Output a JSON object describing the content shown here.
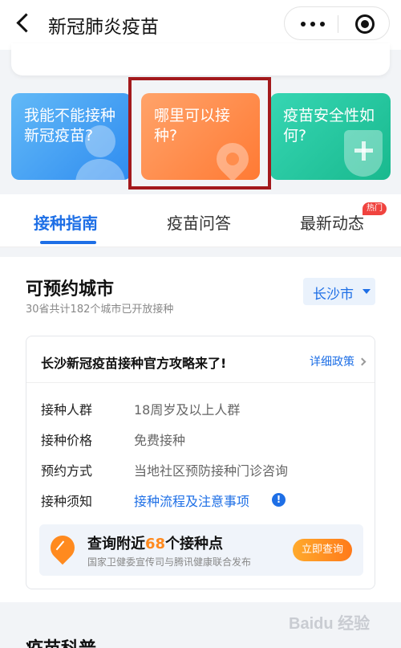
{
  "header": {
    "title": "新冠肺炎疫苗"
  },
  "cards": [
    {
      "label": "我能不能接种新冠疫苗?"
    },
    {
      "label": "哪里可以接种?"
    },
    {
      "label": "疫苗安全性如何?"
    }
  ],
  "tabs": [
    {
      "label": "接种指南",
      "active": true
    },
    {
      "label": "疫苗问答"
    },
    {
      "label": "最新动态",
      "badge": "热门"
    }
  ],
  "section": {
    "title": "可预约城市",
    "subtitle": "30省共计182个城市已开放接种",
    "city": "长沙市"
  },
  "policy": {
    "title": "长沙新冠疫苗接种官方攻略来了!",
    "link": "详细政策",
    "rows": [
      {
        "label": "接种人群",
        "value": "18周岁及以上人群"
      },
      {
        "label": "接种价格",
        "value": "免费接种"
      },
      {
        "label": "预约方式",
        "value": "当地社区预防接种门诊咨询"
      },
      {
        "label": "接种须知",
        "value": "接种流程及注意事项"
      }
    ]
  },
  "query": {
    "title_prefix": "查询附近",
    "count": "68",
    "title_suffix": "个接种点",
    "subtitle": "国家卫健委宣传司与腾讯健康联合发布",
    "button": "立即查询"
  },
  "bottom": {
    "title": "疫苗科普"
  },
  "watermark": "Baidu 经验",
  "colors": {
    "accent": "#1e6fe6",
    "card_blue": "#3f9bf2",
    "card_orange": "#ff8a45",
    "card_green": "#24c79d",
    "highlight_border": "#a3191c",
    "hot_badge": "#f0433f"
  }
}
